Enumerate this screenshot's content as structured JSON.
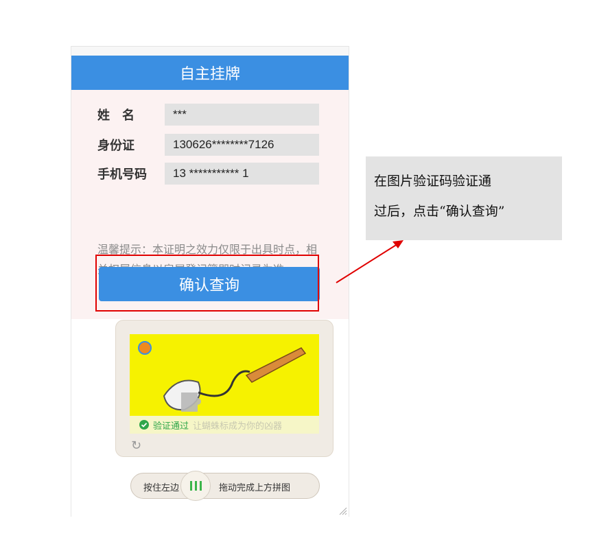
{
  "header": {
    "title": "自主挂牌"
  },
  "form": {
    "name_label": "姓　名",
    "name_value": "***",
    "id_label": "身份证",
    "id_value": "130626********7126",
    "phone_label": "手机号码",
    "phone_value": "13 *********** 1"
  },
  "tip": "温馨提示：本证明之效力仅限于出具时点，相关权属信息以房屋登记簿即时记录为准。",
  "confirm_button": "确认查询",
  "captcha": {
    "status": "验证通过",
    "ghost_text": "让蝴蛛标成为你的凶器",
    "slider_left": "按住左边",
    "slider_right": "拖动完成上方拼图"
  },
  "annotation": {
    "text_line1": "在图片验证码验证通",
    "text_line2": "过后，点击“确认查询”"
  },
  "colors": {
    "accent": "#3b8fe2",
    "highlight_box": "#e00000",
    "success": "#2fa64a",
    "puzzle_bg": "#f6f200"
  },
  "icons": [
    "check-circle-icon",
    "refresh-icon",
    "slider-grip-icon",
    "resize-handle-icon",
    "logo-icon"
  ]
}
